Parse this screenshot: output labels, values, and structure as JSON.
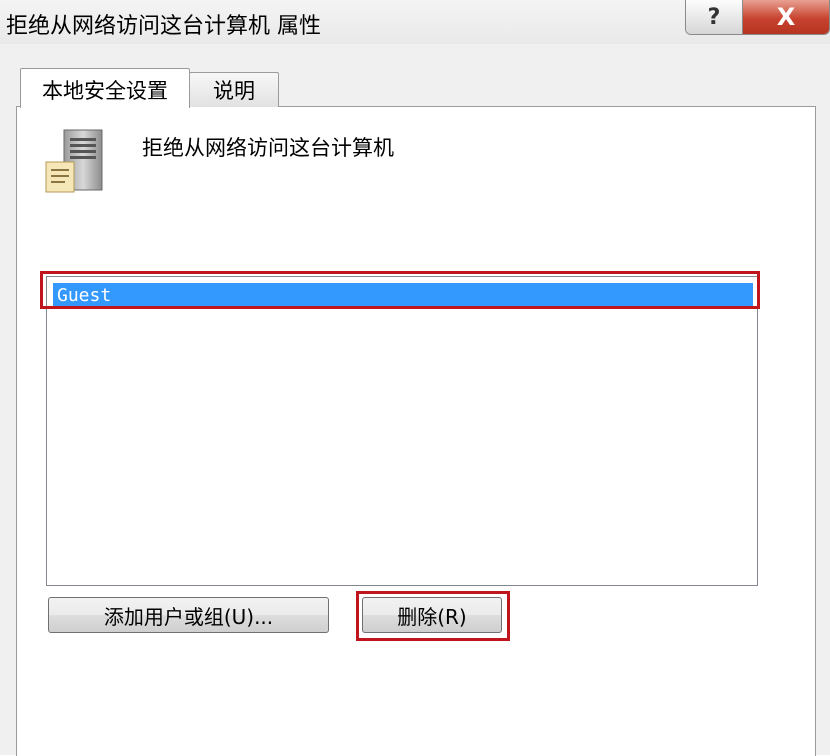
{
  "window": {
    "title": "拒绝从网络访问这台计算机 属性",
    "help_glyph": "?",
    "close_glyph": "X"
  },
  "tabs": [
    {
      "label": "本地安全设置",
      "active": true
    },
    {
      "label": "说明",
      "active": false
    }
  ],
  "policy": {
    "icon": "server-policy-icon",
    "name": "拒绝从网络访问这台计算机"
  },
  "accounts_list": {
    "items": [
      "Guest"
    ],
    "selected_index": 0
  },
  "buttons": {
    "add_label": "添加用户或组(U)...",
    "remove_label": "删除(R)"
  },
  "colors": {
    "selection": "#3399ff",
    "highlight_box": "#c0151c",
    "close_button": "#c7432f"
  }
}
